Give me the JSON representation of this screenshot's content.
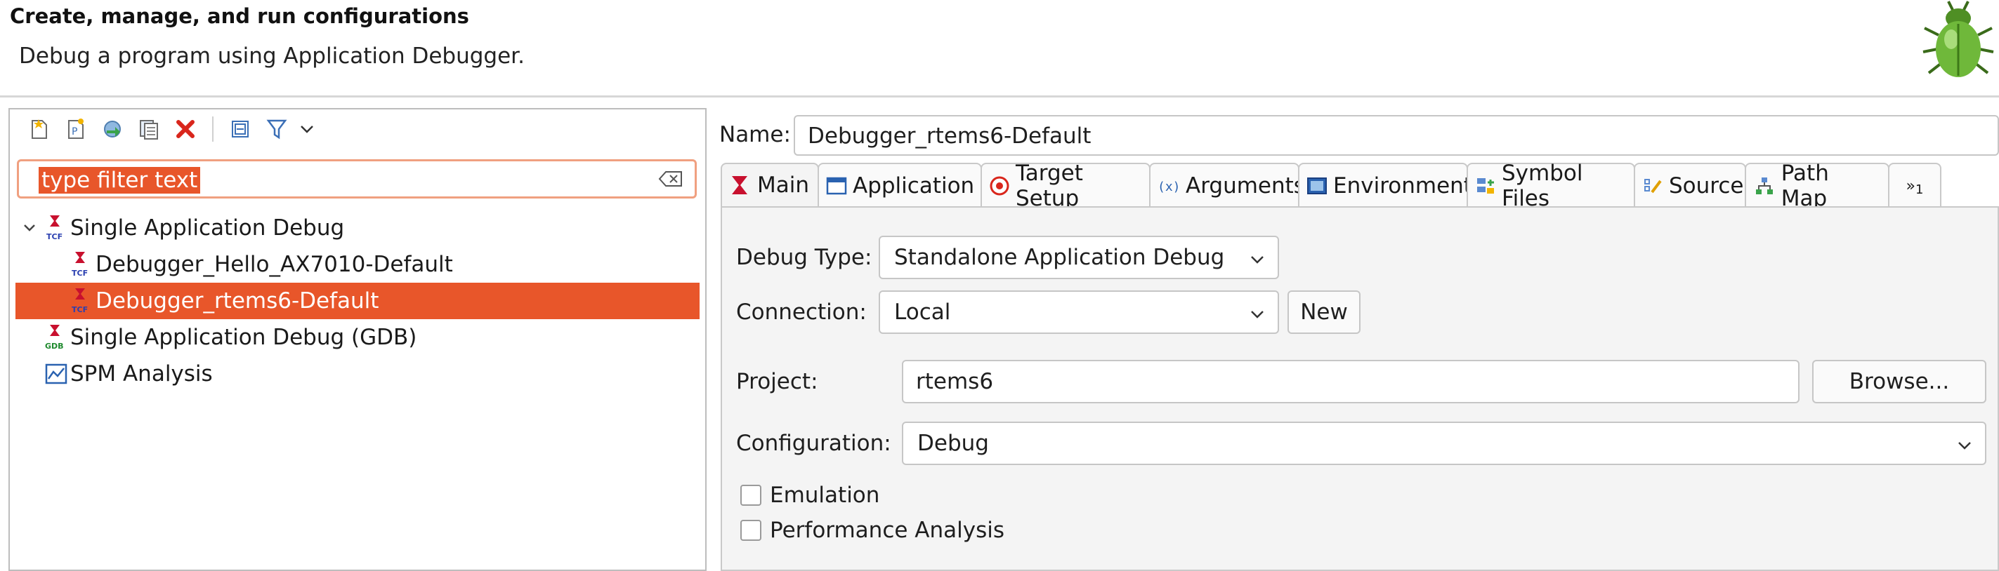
{
  "header": {
    "title": "Create, manage, and run configurations",
    "subtitle": "Debug a program using Application Debugger.",
    "logo_icon": "bug-icon"
  },
  "left": {
    "toolbar": [
      "new-configuration-icon",
      "new-prototype-icon",
      "export-icon",
      "duplicate-icon",
      "delete-icon",
      "collapse-all-icon",
      "filter-icon",
      "chevron-down-icon"
    ],
    "filter": {
      "value": "type filter text"
    },
    "tree": [
      {
        "label": "Single Application Debug",
        "icon": "tcf-icon",
        "expanded": true
      },
      {
        "label": "Debugger_Hello_AX7010-Default",
        "icon": "tcf-icon"
      },
      {
        "label": "Debugger_rtems6-Default",
        "icon": "tcf-icon",
        "selected": true
      },
      {
        "label": "Single Application Debug (GDB)",
        "icon": "gdb-icon"
      },
      {
        "label": "SPM Analysis",
        "icon": "chart-icon"
      }
    ]
  },
  "right": {
    "name_label": "Name:",
    "name_value": "Debugger_rtems6-Default",
    "tabs": [
      {
        "label": "Main",
        "icon": "main-icon"
      },
      {
        "label": "Application",
        "icon": "application-icon"
      },
      {
        "label": "Target Setup",
        "icon": "target-icon"
      },
      {
        "label": "Arguments",
        "icon": "arguments-icon"
      },
      {
        "label": "Environment",
        "icon": "environment-icon"
      },
      {
        "label": "Symbol Files",
        "icon": "symbol-files-icon"
      },
      {
        "label": "Source",
        "icon": "source-icon"
      },
      {
        "label": "Path Map",
        "icon": "path-map-icon"
      }
    ],
    "overflow_tabs": "1",
    "form": {
      "debug_type_label": "Debug Type:",
      "debug_type_value": "Standalone Application Debug",
      "connection_label": "Connection:",
      "connection_value": "Local",
      "new_label": "New",
      "project_label": "Project:",
      "project_value": "rtems6",
      "browse_label": "Browse...",
      "configuration_label": "Configuration:",
      "configuration_value": "Debug",
      "emulation_label": "Emulation",
      "performance_label": "Performance Analysis"
    }
  },
  "colors": {
    "accent": "#e8562a",
    "panel_bg": "#f4f4f4",
    "border": "#c6c6c6"
  }
}
